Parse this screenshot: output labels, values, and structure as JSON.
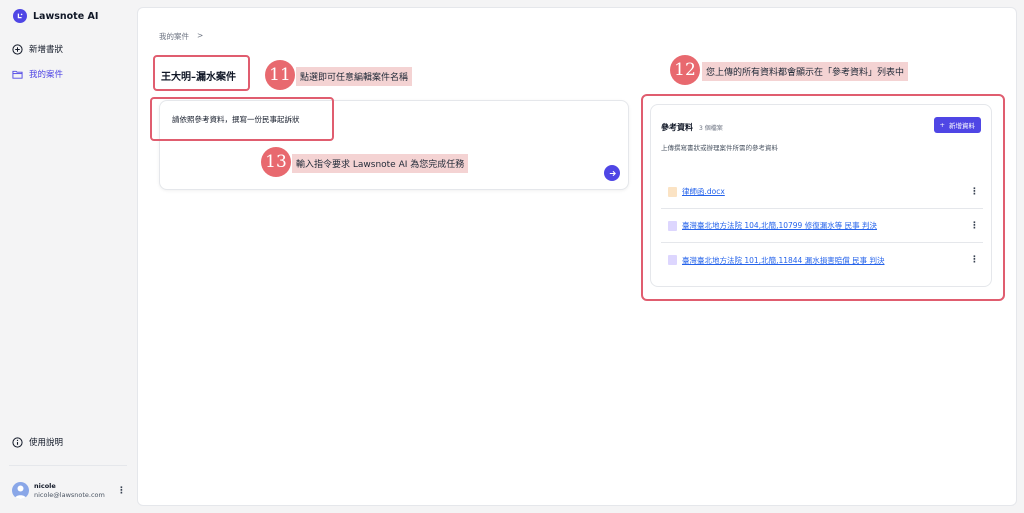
{
  "app": {
    "name": "Lawsnote AI"
  },
  "sidebar": {
    "items": [
      {
        "label": "新增書狀"
      },
      {
        "label": "我的案件"
      }
    ],
    "help_label": "使用說明"
  },
  "user": {
    "name": "nicole",
    "email": "nicole@lawsnote.com"
  },
  "breadcrumb": {
    "root": "我的案件",
    "separator": ">"
  },
  "case": {
    "title": "王大明–漏水案件"
  },
  "prompt": {
    "text": "請依照參考資料，撰寫一份民事起訴狀"
  },
  "annotations": {
    "step11": {
      "number": "11",
      "text": "點選即可任意編輯案件名稱"
    },
    "step12": {
      "number": "12",
      "text": "您上傳的所有資料都會顯示在「參考資料」列表中"
    },
    "step13": {
      "number": "13",
      "text": "輸入指令要求 Lawsnote AI 為您完成任務"
    },
    "color": "#e05d6f",
    "callout_bg": "#f4d3d3"
  },
  "references": {
    "title": "參考資料",
    "count": "3 個檔案",
    "description": "上傳撰寫書狀或辦理案件所需的參考資料",
    "add_label": "新增資料",
    "files": [
      {
        "name": "律師函.docx",
        "icon": "doc-file-icon"
      },
      {
        "name": "臺灣臺北地方法院 104,北簡,10799 修復漏水等 民事 判決",
        "icon": "pdf-file-icon"
      },
      {
        "name": "臺灣臺北地方法院 101,北簡,11844 漏水損害賠償 民事 判決",
        "icon": "pdf-file-icon"
      }
    ]
  },
  "colors": {
    "accent": "#4f46e5",
    "link": "#2563eb"
  }
}
